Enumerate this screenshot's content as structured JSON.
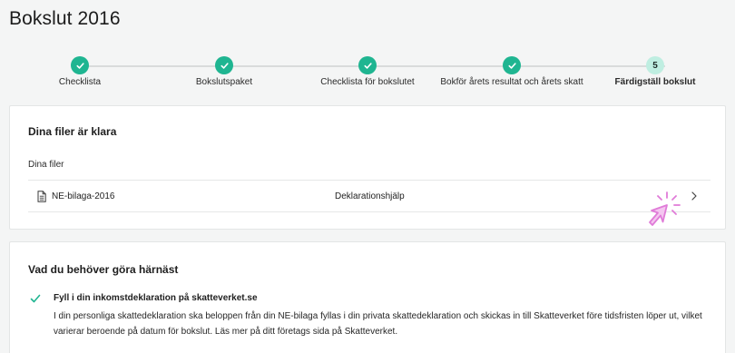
{
  "page": {
    "title": "Bokslut 2016"
  },
  "stepper": {
    "steps": [
      {
        "label": "Checklista",
        "status": "done"
      },
      {
        "label": "Bokslutspaket",
        "status": "done"
      },
      {
        "label": "Checklista för bokslutet",
        "status": "done"
      },
      {
        "label": "Bokför årets resultat och årets skatt",
        "status": "done"
      },
      {
        "label": "Färdigställ bokslut",
        "status": "current",
        "number": "5"
      }
    ]
  },
  "files_card": {
    "heading": "Dina filer är klara",
    "subheading": "Dina filer",
    "file": {
      "name": "NE-bilaga-2016",
      "help": "Deklarationshjälp"
    }
  },
  "next_card": {
    "heading": "Vad du behöver göra härnäst",
    "item": {
      "title": "Fyll i din inkomstdeklaration på skatteverket.se",
      "body": "I din personliga skattedeklaration ska beloppen från din NE-bilaga fyllas i din privata skattedeklaration och skickas in till Skatteverket före tidsfristen löper ut, vilket varierar beroende på datum för bokslut. Läs mer på ditt företags sida på Skatteverket."
    }
  },
  "colors": {
    "accent": "#1fb591",
    "current_step": "#bfeee1",
    "pointer": "#e07bd8",
    "background": "#f4f5f5"
  },
  "icons": [
    "check-icon",
    "file-icon",
    "chevron-right-icon",
    "pointer-click-icon"
  ]
}
